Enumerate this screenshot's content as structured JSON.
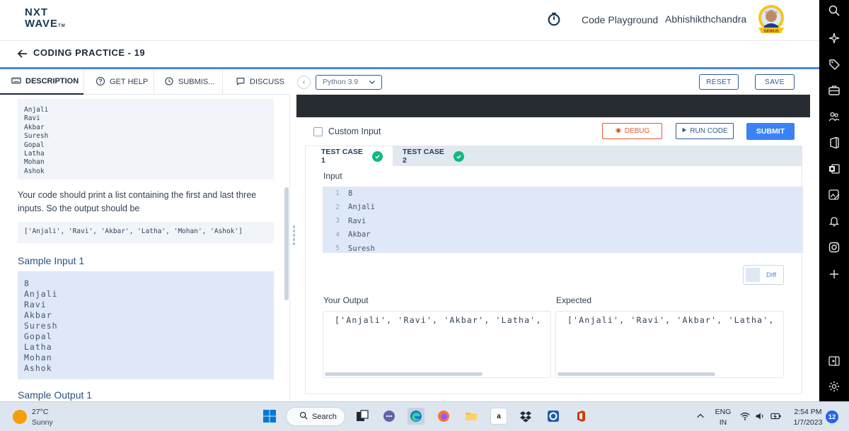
{
  "header": {
    "logo_line1": "NXT",
    "logo_line2": "WAVE",
    "logo_tm": "TM",
    "playground_label": "Code Playground",
    "username": "Abhishikthchandra",
    "avatar_badge": "GENIUS"
  },
  "subheader": {
    "title": "CODING PRACTICE - 19"
  },
  "left_tabs": [
    {
      "label": "DESCRIPTION",
      "icon": "keyboard-icon"
    },
    {
      "label": "GET HELP",
      "icon": "help-circle-icon"
    },
    {
      "label": "SUBMIS...",
      "icon": "clock-icon"
    },
    {
      "label": "DISCUSS",
      "icon": "chat-icon"
    }
  ],
  "description": {
    "names_block": "Anjali\nRavi\nAkbar\nSuresh\nGopal\nLatha\nMohan\nAshok",
    "paragraph": "Your code should print a list containing the first and last three inputs. So the output should be",
    "expected_output": "['Anjali', 'Ravi', 'Akbar', 'Latha', 'Mohan', 'Ashok']",
    "sample_input_heading": "Sample Input 1",
    "sample_input": "8\nAnjali\nRavi\nAkbar\nSuresh\nGopal\nLatha\nMohan\nAshok",
    "sample_output_heading": "Sample Output 1"
  },
  "editor_toolbar": {
    "language": "Python 3.9",
    "reset_label": "RESET",
    "save_label": "SAVE"
  },
  "run_panel": {
    "custom_input_label": "Custom Input",
    "custom_input_checked": false,
    "debug_label": "DEBUG",
    "run_label": "RUN CODE",
    "submit_label": "SUBMIT"
  },
  "test_cases": {
    "tabs": [
      {
        "label": "TEST CASE 1",
        "status": "passed"
      },
      {
        "label": "TEST CASE 2",
        "status": "passed"
      }
    ],
    "input_label": "Input",
    "input_lines": [
      {
        "num": "1",
        "text": "8"
      },
      {
        "num": "2",
        "text": "Anjali"
      },
      {
        "num": "3",
        "text": "Ravi"
      },
      {
        "num": "4",
        "text": "Akbar"
      },
      {
        "num": "5",
        "text": "Suresh"
      }
    ],
    "diff_label": "Diff",
    "your_output_label": "Your Output",
    "expected_label": "Expected",
    "your_output": "['Anjali', 'Ravi', 'Akbar', 'Latha',",
    "expected_output": "['Anjali', 'Ravi', 'Akbar', 'Latha',"
  },
  "taskbar": {
    "temperature": "27°C",
    "condition": "Sunny",
    "search_label": "Search",
    "lang_line1": "ENG",
    "lang_line2": "IN",
    "time": "2:54 PM",
    "date": "1/7/2023",
    "notification_count": "12"
  },
  "colors": {
    "accent_blue": "#3b82f6",
    "nav_blue": "#2d5b9a",
    "success_green": "#10b981",
    "debug_orange": "#e05830",
    "editor_dark": "#272c33"
  }
}
